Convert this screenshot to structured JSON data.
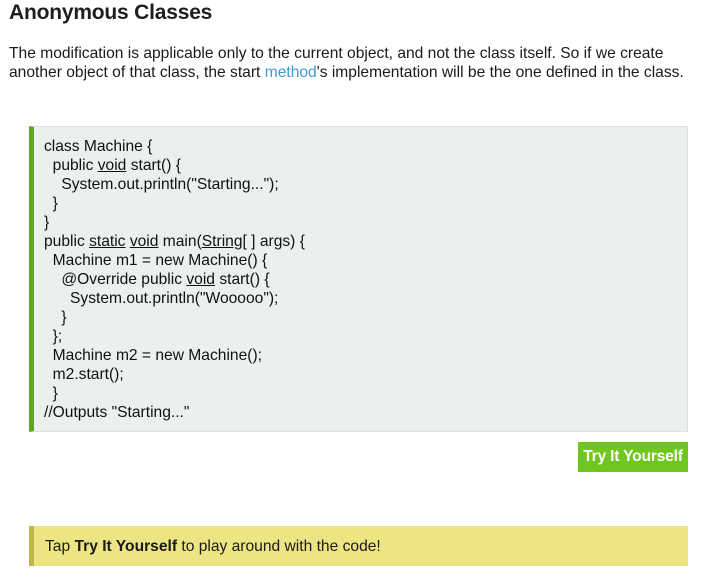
{
  "lesson": {
    "title": "Anonymous Classes",
    "paragraph": {
      "part1": "The modification is applicable only to the current object, and not the class itself. So if we create another object of that class, the start ",
      "link": "method",
      "part2": "'s implementation will be the one defined in the class."
    }
  },
  "code": {
    "lines": [
      [
        {
          "t": "class Machine {"
        }
      ],
      [
        {
          "t": "  public "
        },
        {
          "t": "void",
          "u": true
        },
        {
          "t": " start() {"
        }
      ],
      [
        {
          "t": "    System.out.println(\"Starting...\");"
        }
      ],
      [
        {
          "t": "  }"
        }
      ],
      [
        {
          "t": "}"
        }
      ],
      [
        {
          "t": "public "
        },
        {
          "t": "static",
          "u": true
        },
        {
          "t": " "
        },
        {
          "t": "void",
          "u": true
        },
        {
          "t": " main("
        },
        {
          "t": "String",
          "u": true
        },
        {
          "t": "[ ] args) {"
        }
      ],
      [
        {
          "t": "  Machine m1 = new Machine() {"
        }
      ],
      [
        {
          "t": "    @Override public "
        },
        {
          "t": "void",
          "u": true
        },
        {
          "t": " start() {"
        }
      ],
      [
        {
          "t": "      System.out.println(\"Wooooo\");"
        }
      ],
      [
        {
          "t": "    }"
        }
      ],
      [
        {
          "t": "  };"
        }
      ],
      [
        {
          "t": "  Machine m2 = new Machine();"
        }
      ],
      [
        {
          "t": "  m2.start();"
        }
      ],
      [
        {
          "t": "  }"
        }
      ],
      [
        {
          "t": "//Outputs \"Starting...\""
        }
      ]
    ]
  },
  "try_button": {
    "label": "Try It Yourself"
  },
  "tip": {
    "prefix": "Tap ",
    "bold": "Try It Yourself",
    "suffix": " to play around with the code!"
  },
  "colors": {
    "link": "#3f9dd2",
    "code_border": "#5fa52b",
    "code_background": "#eceff0",
    "button_background": "#6ec61e",
    "tip_background": "#ede583",
    "tip_border": "#bfb64a"
  }
}
